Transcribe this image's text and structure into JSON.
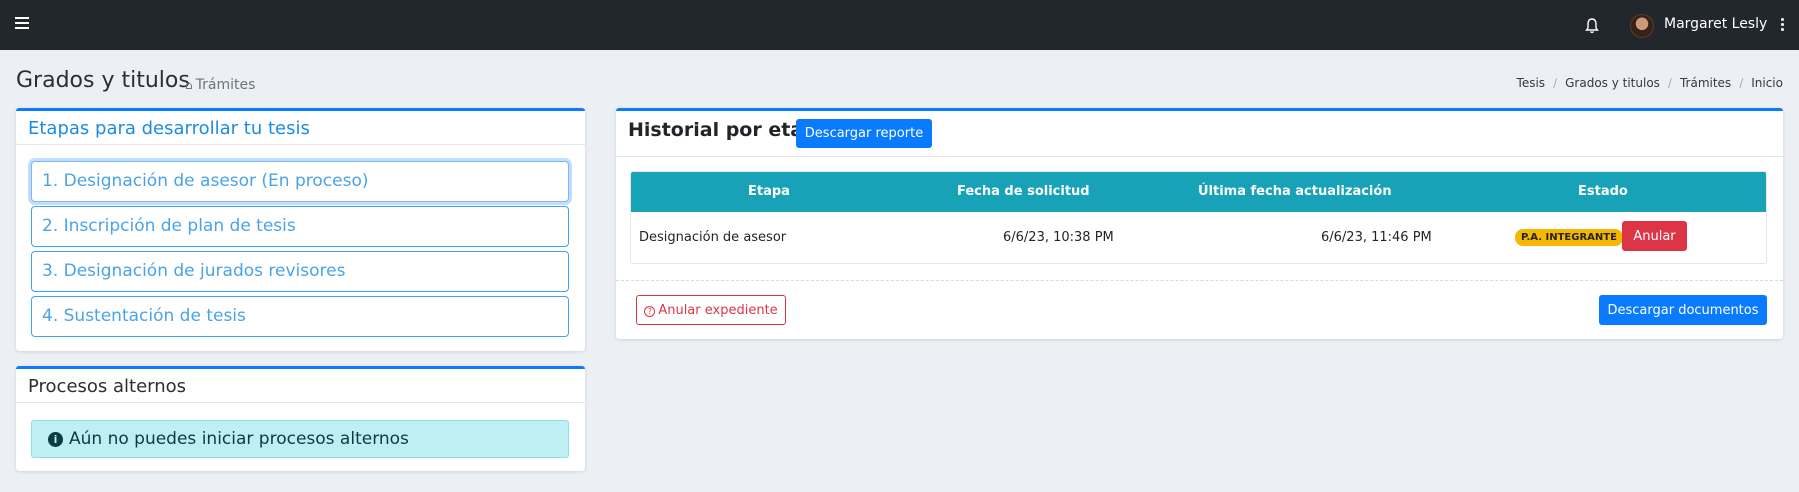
{
  "navbar": {
    "menu_icon": "hamburger-icon",
    "bell_icon": "bell-icon",
    "user_name": "Margaret Lesly",
    "more_icon": "kebab-icon"
  },
  "header": {
    "title": "Grados y titulos",
    "subtitle": "Trámites",
    "home_icon": "home-icon",
    "breadcrumb": [
      "Tesis",
      "Grados y titulos",
      "Trámites",
      "Inicio"
    ]
  },
  "stages_card": {
    "title": "Etapas para desarrollar tu tesis",
    "items": [
      {
        "label": "1. Designación de asesor (En proceso)"
      },
      {
        "label": "2. Inscripción de plan de tesis"
      },
      {
        "label": "3. Designación de jurados revisores"
      },
      {
        "label": "4. Sustentación de tesis"
      }
    ]
  },
  "alt_card": {
    "title": "Procesos alternos",
    "alert": "Aún no puedes iniciar procesos alternos",
    "alert_icon": "info-icon"
  },
  "history_card": {
    "title": "Historial por etapa",
    "report_button": "Descargar reporte",
    "columns": [
      "Etapa",
      "Fecha de solicitud",
      "Última fecha actualización",
      "Estado"
    ],
    "rows": [
      {
        "etapa": "Designación de asesor",
        "fecha_solicitud": "6/6/23, 10:38 PM",
        "ultima_fecha": "6/6/23, 11:46 PM",
        "estado": "P.A. INTEGRANTE",
        "action": "Anular"
      }
    ],
    "cancel_file_button": "Anular expediente",
    "download_docs_button": "Descargar documentos"
  },
  "colors": {
    "navbar": "#21272c",
    "primary": "#0a7bff",
    "table_header": "#17a2b8",
    "danger": "#dc3545",
    "warning": "#f5b700",
    "info_bg": "#bfeef3"
  }
}
